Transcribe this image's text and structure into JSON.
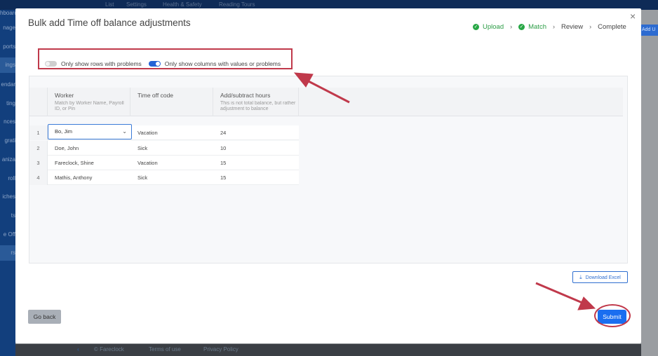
{
  "background": {
    "topbar_items": [
      "List",
      "Settings",
      "Health & Safety",
      "Reading Tours"
    ],
    "sidebar_items": [
      "hboard",
      "nage",
      "ports",
      "ings",
      "endar",
      "ting",
      "nces",
      "grati",
      "aniza",
      "roll",
      "iches",
      "ts",
      "e Off",
      "rs"
    ],
    "add_user_label": "Add U",
    "footer_items": [
      "© Fareclock",
      "Terms of use",
      "Privacy Policy"
    ]
  },
  "modal": {
    "title": "Bulk add Time off balance adjustments",
    "close_label": "×",
    "steps": [
      {
        "label": "Upload",
        "done": true
      },
      {
        "label": "Match",
        "done": true
      },
      {
        "label": "Review",
        "done": false
      },
      {
        "label": "Complete",
        "done": false
      }
    ],
    "step_separator": "›",
    "toggles": {
      "rows_with_problems": {
        "label": "Only show rows with problems",
        "on": false
      },
      "columns_with_values": {
        "label": "Only show columns with values or problems",
        "on": true
      }
    },
    "table": {
      "columns": [
        {
          "header": "Worker",
          "sub": "Match by Worker Name, Payroll ID, or Pin"
        },
        {
          "header": "Time off code",
          "sub": ""
        },
        {
          "header": "Add/subtract hours",
          "sub": "This is not total balance, but rather adjustment to balance"
        }
      ],
      "rows": [
        {
          "num": "1",
          "worker": "Bo, Jim",
          "code": "Vacation",
          "hours": "24"
        },
        {
          "num": "2",
          "worker": "Doe, John",
          "code": "Sick",
          "hours": "10"
        },
        {
          "num": "3",
          "worker": "Fareclock, Shine",
          "code": "Vacation",
          "hours": "15"
        },
        {
          "num": "4",
          "worker": "Mathis, Anthony",
          "code": "Sick",
          "hours": "15"
        }
      ],
      "dropdown_chevron": "⌄"
    },
    "download_label": "Download Excel",
    "go_back_label": "Go back",
    "submit_label": "Submit"
  },
  "colors": {
    "accent": "#1a6ef0",
    "success": "#27a745",
    "annotation": "#c0394b"
  }
}
